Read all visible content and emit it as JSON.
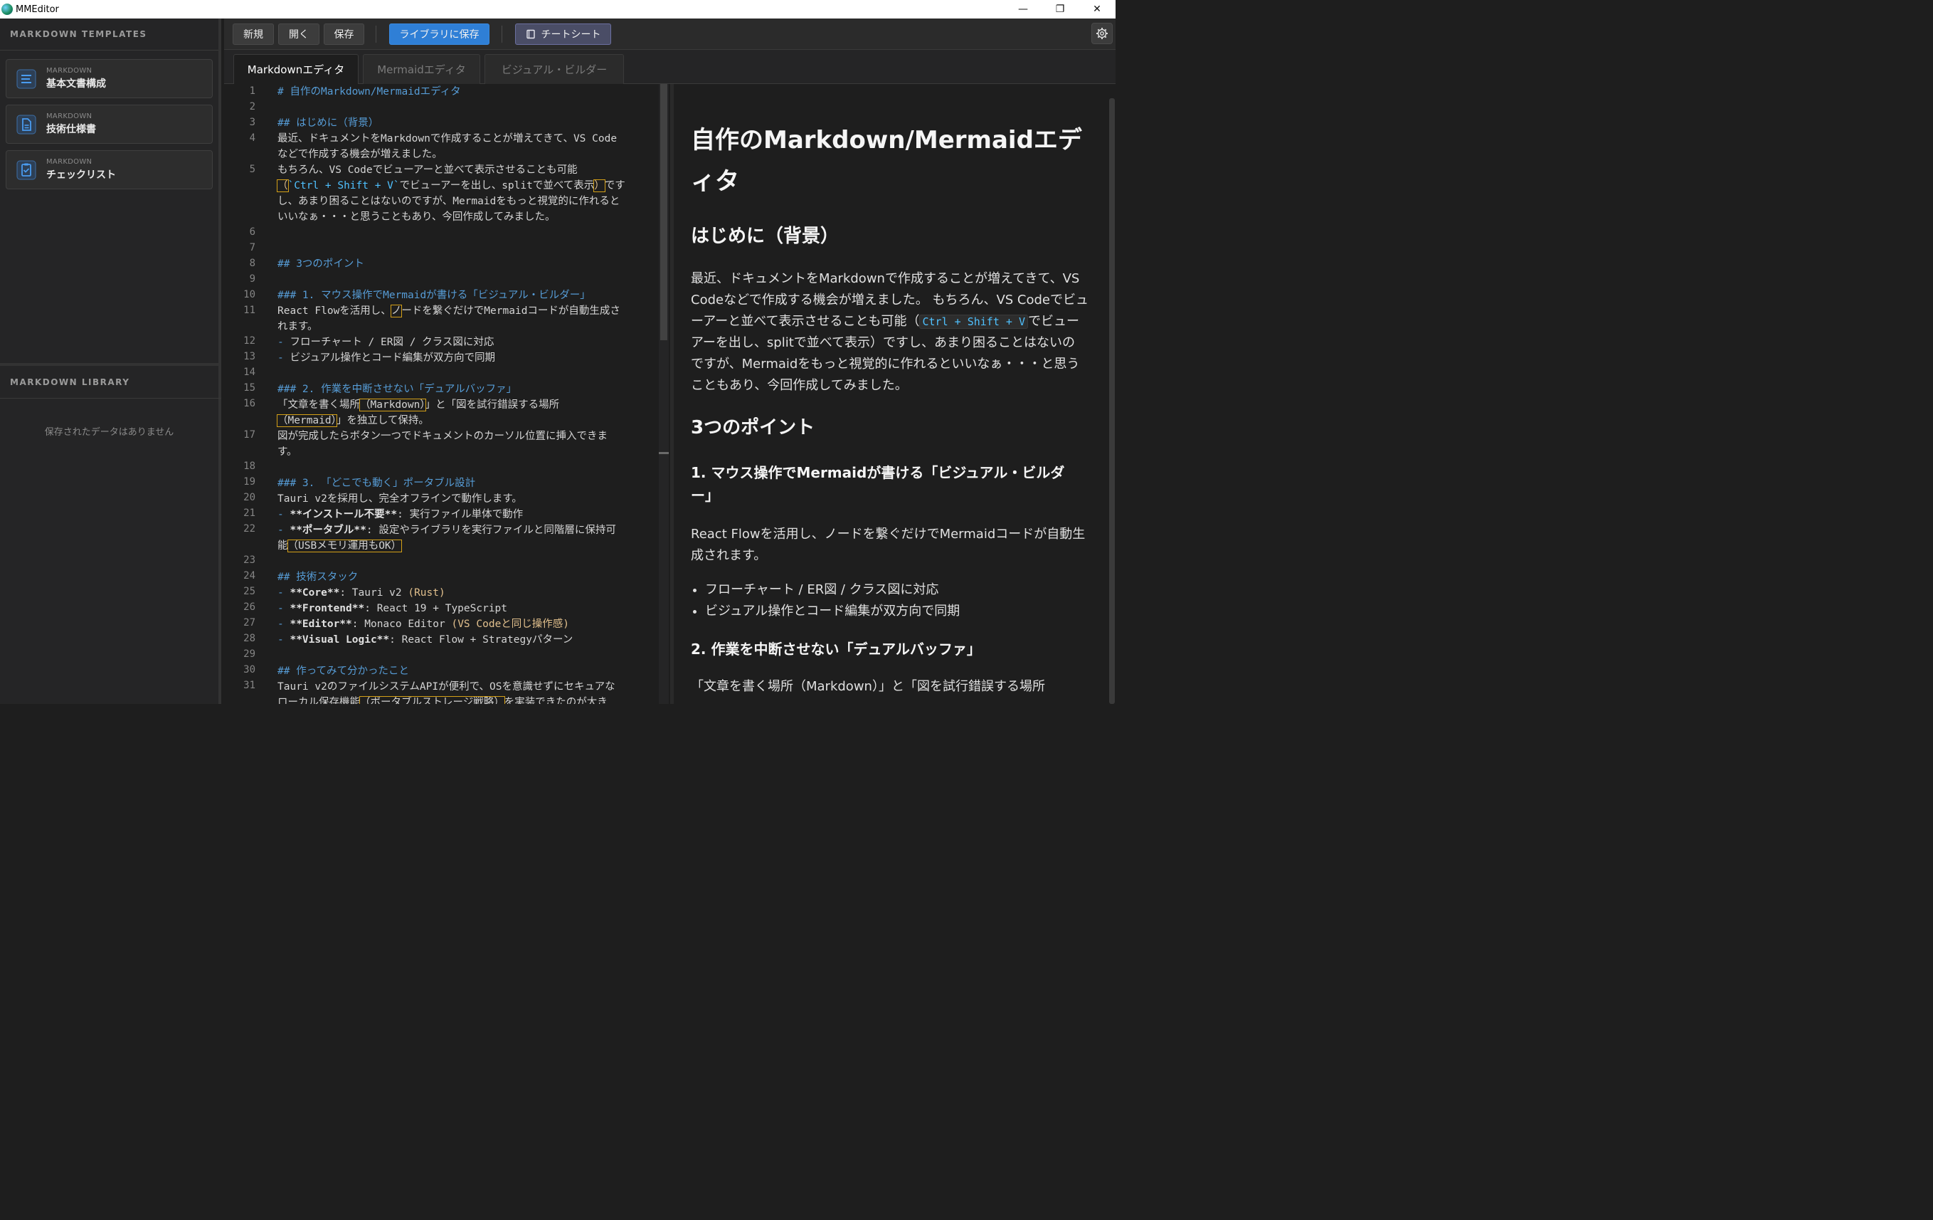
{
  "window": {
    "title": "MMEditor",
    "minimize": "—",
    "maximize": "❐",
    "close": "✕"
  },
  "sidebar": {
    "templates_header": "MARKDOWN TEMPLATES",
    "templates": [
      {
        "category": "MARKDOWN",
        "name": "基本文書構成",
        "icon": "list-lines-icon"
      },
      {
        "category": "MARKDOWN",
        "name": "技術仕様書",
        "icon": "document-icon"
      },
      {
        "category": "MARKDOWN",
        "name": "チェックリスト",
        "icon": "clipboard-check-icon"
      }
    ],
    "library_header": "MARKDOWN LIBRARY",
    "library_empty": "保存されたデータはありません"
  },
  "toolbar": {
    "new_label": "新規",
    "open_label": "開く",
    "save_label": "保存",
    "save_library_label": "ライブラリに保存",
    "cheatsheet_label": "チートシート"
  },
  "tabs": [
    "Markdownエディタ",
    "Mermaidエディタ",
    "ビジュアル・ビルダー"
  ],
  "editor": {
    "line_numbers": [
      "1",
      "2",
      "3",
      "4",
      "5",
      "6",
      "7",
      "8",
      "9",
      "10",
      "11",
      "12",
      "13",
      "14",
      "15",
      "16",
      "17",
      "18",
      "19",
      "20",
      "21",
      "22",
      "23",
      "24",
      "25",
      "26",
      "27",
      "28",
      "29",
      "30",
      "31"
    ],
    "lines": {
      "l1": "# 自作のMarkdown/Mermaidエディタ",
      "l3": "## はじめに（背景）",
      "l4a": "最近、ドキュメントをMarkdownで作成することが増えてきて、VS Code",
      "l4b": "などで作成する機会が増えました。",
      "l5a": "もちろん、VS Codeでビューアーと並べて表示させることも可能",
      "l5b_1": "（",
      "l5b_2": "`Ctrl + Shift + V`",
      "l5b_3": "でビューアーを出し、splitで並べて表示",
      "l5b_4": "）",
      "l5b_5": "です",
      "l5c": "し、あまり困ることはないのですが、Mermaidをもっと視覚的に作れると",
      "l5d": "いいなぁ・・・と思うこともあり、今回作成してみました。",
      "l8": "## 3つのポイント",
      "l10": "### 1. マウス操作でMermaidが書ける「ビジュアル・ビルダー」",
      "l11a_1": "React Flowを活用し、",
      "l11a_2": "ノ",
      "l11a_3": "ードを繋ぐだけでMermaidコードが自動生成さ",
      "l11b": "れます。",
      "l12_b": "- ",
      "l12": "フローチャート / ER図 / クラス図に対応",
      "l13_b": "- ",
      "l13": "ビジュアル操作とコード編集が双方向で同期",
      "l15": "### 2. 作業を中断させない「デュアルバッファ」",
      "l16a_1": "「文章を書く場所",
      "l16a_2": "（Markdown）",
      "l16a_3": "」と「図を試行錯誤する場所",
      "l16b_1": "（Mermaid）",
      "l16b_2": "」を独立して保持。",
      "l17a": "図が完成したらボタン一つでドキュメントのカーソル位置に挿入できま",
      "l17b": "す。",
      "l19": "### 3. 「どこでも動く」ポータブル設計",
      "l20": "Tauri v2を採用し、完全オフラインで動作します。",
      "l21_b": "- ",
      "l21_s": "**インストール不要**",
      "l21_t": ": 実行ファイル単体で動作",
      "l22a_b": "- ",
      "l22a_s": "**ポータブル**",
      "l22a_t": ": 設定やライブラリを実行ファイルと同階層に保持可",
      "l22b_1": "能",
      "l22b_2": "（USBメモリ運用もOK）",
      "l24": "## 技術スタック",
      "l25_b": "- ",
      "l25_s": "**Core**",
      "l25_t": ": Tauri v2 ",
      "l25_p": "(Rust)",
      "l26_b": "- ",
      "l26_s": "**Frontend**",
      "l26_t": ": React 19 + TypeScript",
      "l27_b": "- ",
      "l27_s": "**Editor**",
      "l27_t": ": Monaco Editor ",
      "l27_p": "(VS Codeと同じ操作感)",
      "l28_b": "- ",
      "l28_s": "**Visual Logic**",
      "l28_t": ": React Flow + Strategyパターン",
      "l30": "## 作ってみて分かったこと",
      "l31a": "Tauri v2のファイルシステムAPIが便利で、OSを意識せずにセキュアな",
      "l31b_1": "ローカル保存機能",
      "l31b_2": "（ポータブルストレージ戦略）",
      "l31b_3": "を実装できたのが大き"
    }
  },
  "preview": {
    "h1_line1": "自作のMarkdown/Mermaidエデ",
    "h1_line2": "ィタ",
    "h2_intro": "はじめに（背景）",
    "intro_1": "最近、ドキュメントをMarkdownで作成することが増えてきて、VS",
    "intro_2": "Codeなどで作成する機会が増えました。 もちろん、VS Codeでビュ",
    "intro_3a": "ーアーと並べて表示させることも可能（",
    "intro_3code": "Ctrl + Shift + V",
    "intro_3b": "でビュー",
    "intro_4": "アーを出し、splitで並べて表示）ですし、あまり困ることはないの",
    "intro_5": "ですが、Mermaidをもっと視覚的に作れるといいなぁ・・・と思う",
    "intro_6": "こともあり、今回作成してみました。",
    "h2_points": "3つのポイント",
    "h3_1_line1": "1. マウス操作でMermaidが書ける「ビジュアル・ビルダ",
    "h3_1_line2": "ー」",
    "p1_1": "React Flowを活用し、ノードを繋ぐだけでMermaidコードが自動生",
    "p1_2": "成されます。",
    "list1": [
      "フローチャート / ER図 / クラス図に対応",
      "ビジュアル操作とコード編集が双方向で同期"
    ],
    "h3_2": "2. 作業を中断させない「デュアルバッファ」",
    "p2_1": "「文章を書く場所（Markdown）」と「図を試行錯誤する場所"
  }
}
